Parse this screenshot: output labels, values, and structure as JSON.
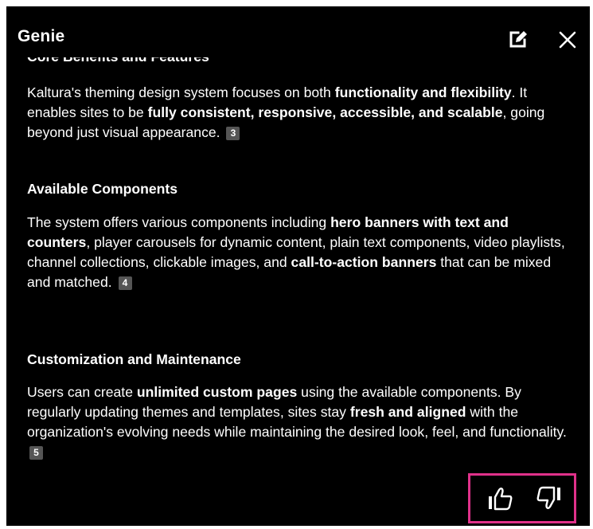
{
  "header": {
    "title": "Genie",
    "edit_icon": "edit-pencil-icon",
    "close_icon": "close-icon"
  },
  "content": {
    "cut_heading": "Core Benefits and Features",
    "section1": {
      "p_a": "Kaltura's theming design system focuses on both ",
      "p_b": "functionality and flexibility",
      "p_c": ". It enables sites to be ",
      "p_d": "fully consistent, responsive, accessible, and scalable",
      "p_e": ", going beyond just visual appearance.",
      "ref": "3"
    },
    "section2": {
      "heading": "Available Components",
      "p_a": "The system offers various components including ",
      "p_b": "hero banners with text and counters",
      "p_c": ", player carousels for dynamic content, plain text components, video playlists, channel collections, clickable images, and ",
      "p_d": "call-to-action banners",
      "p_e": " that can be mixed and matched.",
      "ref": "4"
    },
    "section3": {
      "heading": "Customization and Maintenance",
      "p_a": "Users can create ",
      "p_b": "unlimited custom pages",
      "p_c": " using the available components. By regularly updating themes and templates, sites stay ",
      "p_d": "fresh and aligned",
      "p_e": " with the organization's evolving needs while maintaining the desired look, feel, and functionality.",
      "ref": "5"
    }
  },
  "feedback": {
    "thumbs_up_icon": "thumbs-up-icon",
    "thumbs_down_icon": "thumbs-down-icon",
    "highlight_color": "#e0318a"
  },
  "colors": {
    "panel_background": "#000000",
    "text": "#ffffff",
    "reference_badge": "#555555"
  }
}
